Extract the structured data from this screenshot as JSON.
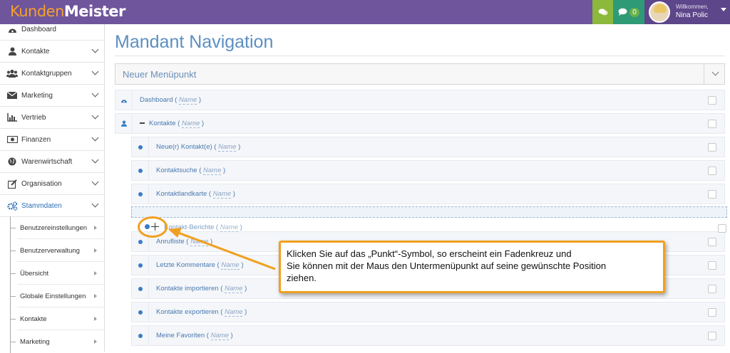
{
  "app": {
    "logo_part1": "Kunden",
    "logo_part2": "Meister",
    "chat_badge": "0",
    "welcome": "Willkommen,",
    "user_name": "Nina Polic"
  },
  "sidebar": {
    "items": [
      {
        "label": "Dashboard",
        "icon": "dashboard-icon"
      },
      {
        "label": "Kontakte",
        "icon": "user-icon"
      },
      {
        "label": "Kontaktgruppen",
        "icon": "users-icon"
      },
      {
        "label": "Marketing",
        "icon": "envelope-icon"
      },
      {
        "label": "Vertrieb",
        "icon": "bar-chart-icon"
      },
      {
        "label": "Finanzen",
        "icon": "money-icon"
      },
      {
        "label": "Warenwirtschaft",
        "icon": "globe-icon"
      },
      {
        "label": "Organisation",
        "icon": "edit-icon"
      },
      {
        "label": "Stammdaten",
        "icon": "cogs-icon"
      }
    ],
    "subitems": [
      {
        "label": "Benutzereinstellungen"
      },
      {
        "label": "Benutzerverwaltung"
      },
      {
        "label": "Übersicht"
      },
      {
        "label": "Globale Einstellungen"
      },
      {
        "label": "Kontakte"
      },
      {
        "label": "Marketing"
      }
    ]
  },
  "main": {
    "title": "Mandant Navigation",
    "select_value": "Neuer Menüpunkt",
    "name_placeholder": "Name",
    "top_rows": [
      {
        "label": "Dashboard"
      },
      {
        "label": "Kontakte"
      }
    ],
    "child_rows": [
      {
        "label": "Neue(r) Kontakt(e)"
      },
      {
        "label": "Kontaktsuche"
      },
      {
        "label": "Kontaktlandkarte"
      }
    ],
    "dragged_row": {
      "label": "Kontakt-Berichte"
    },
    "lower_rows": [
      {
        "label": "Anrufliste"
      },
      {
        "label": "Letzte Kommentare"
      },
      {
        "label": "Kontakte importieren"
      },
      {
        "label": "Kontakte exportieren"
      },
      {
        "label": "Meine Favoriten"
      }
    ]
  },
  "callout": {
    "line1": "Klicken Sie auf das „Punkt“-Symbol, so erscheint ein Fadenkreuz und",
    "line2": "Sie können mit der Maus den Untermenüpunkt auf seine gewünschte Position",
    "line3": "ziehen."
  },
  "colors": {
    "topbar": "#6f559c",
    "accent_orange": "#f0a020",
    "link_blue": "#4a79b0"
  }
}
